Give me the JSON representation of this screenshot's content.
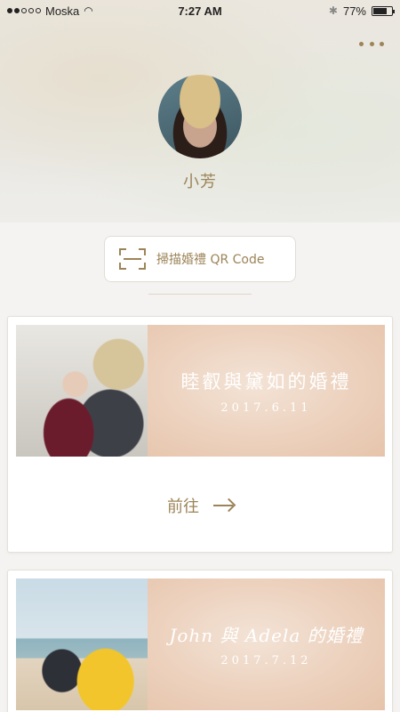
{
  "status_bar": {
    "carrier": "Moska",
    "time": "7:27 AM",
    "battery": "77%",
    "battery_level": 0.77
  },
  "profile": {
    "name": "小芳"
  },
  "scan": {
    "label": "掃描婚禮 QR Code"
  },
  "weddings": [
    {
      "title": "睦叡與黛如的婚禮",
      "date": "2017.6.11",
      "go_label": "前往"
    },
    {
      "title": "John 與 Adela 的婚禮",
      "date": "2017.7.12"
    }
  ],
  "colors": {
    "accent": "#9c8458",
    "card_title_bg": "#ecd1bd"
  }
}
